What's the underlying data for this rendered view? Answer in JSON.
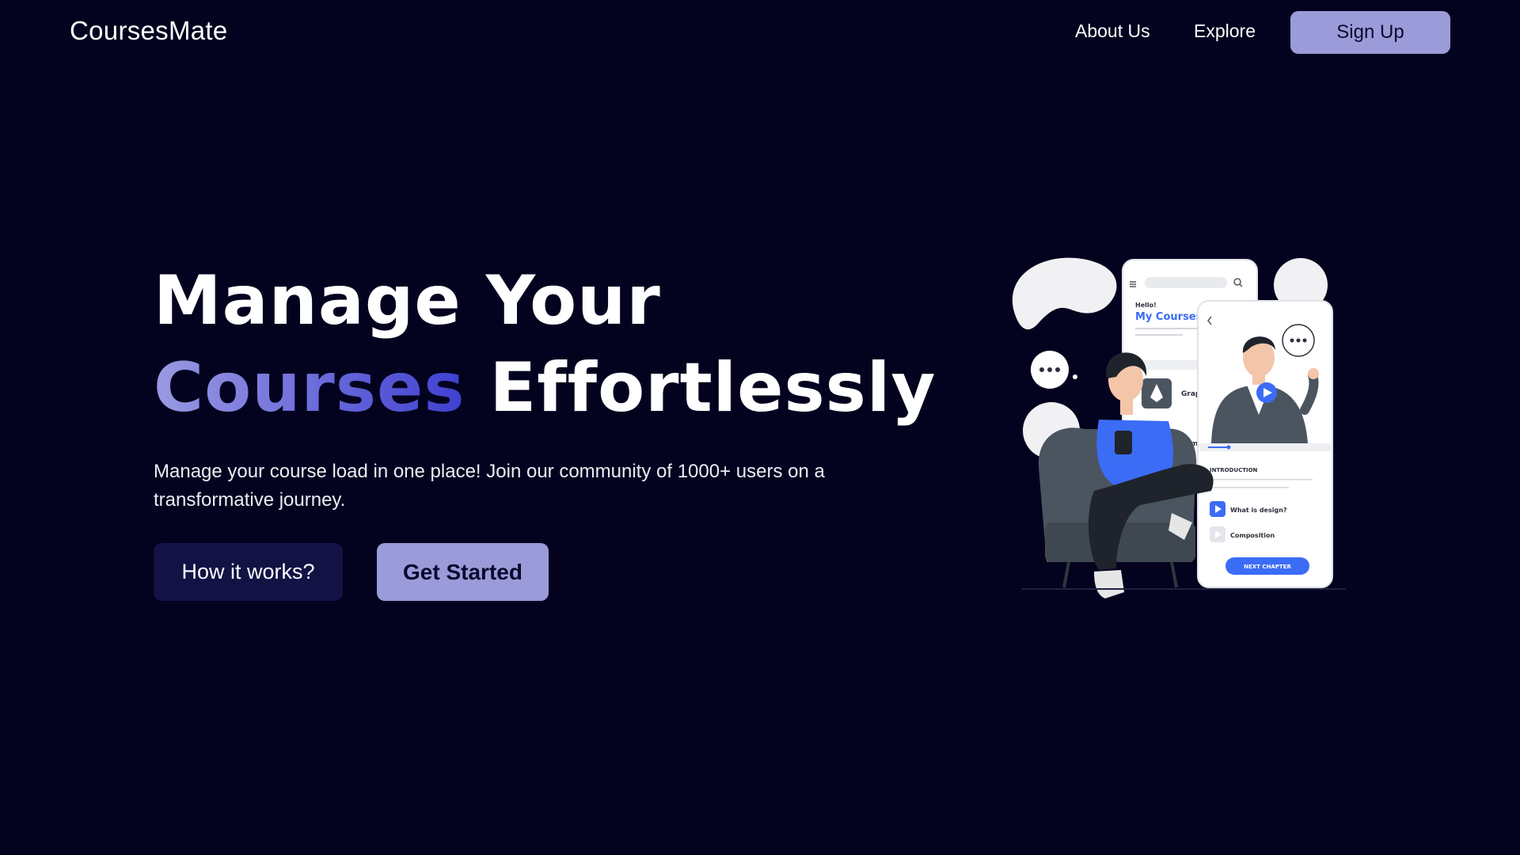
{
  "header": {
    "brand": "CoursesMate",
    "nav": {
      "about": "About Us",
      "explore": "Explore"
    },
    "signup_label": "Sign Up"
  },
  "hero": {
    "title_line1": "Manage Your",
    "title_highlight": "Courses",
    "title_rest": "Effortlessly",
    "subtitle": "Manage your course load in one place! Join our community of 1000+ users on a transformative journey.",
    "buttons": {
      "how_label": "How it works?",
      "start_label": "Get Started"
    }
  },
  "illustration": {
    "phone_back": {
      "greeting": "Hello!",
      "title": "My Courses",
      "item1": "Grap",
      "item2": "Htm"
    },
    "phone_front": {
      "chapter1": "INTRODUCTION",
      "chapter2": "What is design?",
      "chapter3": "Composition",
      "next_button": "NEXT CHAPTER"
    },
    "icons": [
      "chat-dots-icon",
      "play-icon",
      "search-icon",
      "menu-icon",
      "back-arrow-icon",
      "pen-tool-icon"
    ]
  },
  "colors": {
    "background": "#03031f",
    "accent": "#9b9bd9",
    "button_dark": "#121245",
    "gradient_start": "#9a9ae2",
    "gradient_end": "#3f3fd0",
    "illustration_blue": "#3b6cf6"
  }
}
